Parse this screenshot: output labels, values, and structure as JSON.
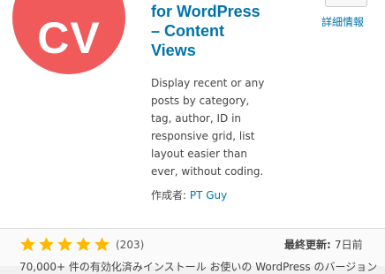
{
  "plugin": {
    "logo_text": "CV",
    "title_lines": [
      "for WordPress",
      "– Content",
      "Views"
    ],
    "description_lines": [
      "Display recent or any",
      "posts by category,",
      "tag, author, ID in",
      "responsive grid, list",
      "layout easier than",
      "ever, without coding."
    ],
    "details_link": "詳細情報",
    "author_label": "作成者: ",
    "author_name": "PT Guy"
  },
  "footer": {
    "rating_stars": 5,
    "rating_count": "(203)",
    "updated_label": "最終更新: ",
    "updated_value": "7日前",
    "installs_text": "70,000+ 件の有効化済みインストール お使いの WordPress のバージョン"
  },
  "colors": {
    "logo_bg": "#f15a5b",
    "link": "#0073aa",
    "star": "#ffb900"
  }
}
